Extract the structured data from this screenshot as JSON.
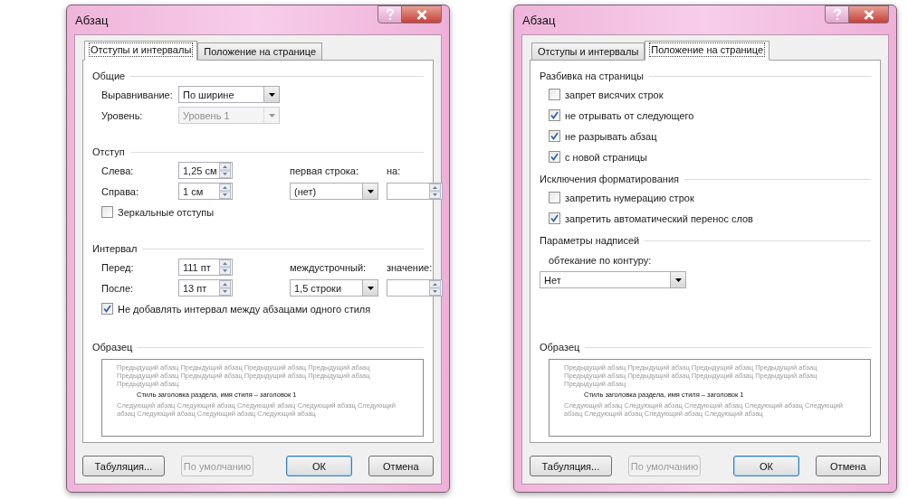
{
  "dialogs": [
    {
      "title": "Абзац",
      "tabs": [
        {
          "label": "Отступы и интервалы",
          "selected": true
        },
        {
          "label": "Положение на странице",
          "selected": false
        }
      ],
      "sections": [
        {
          "heading": "Общие",
          "rows": [
            [
              {
                "kind": "label",
                "text": "Выравнивание:"
              },
              {
                "kind": "select",
                "value": "По ширине",
                "disabled": false
              }
            ],
            [
              {
                "kind": "label",
                "text": "Уровень:"
              },
              {
                "kind": "select",
                "value": "Уровень 1",
                "disabled": true
              }
            ]
          ]
        },
        {
          "heading": "Отступ",
          "rows": [
            [
              {
                "kind": "label",
                "text": "Слева:"
              },
              {
                "kind": "spin",
                "value": "1,25 см"
              },
              {
                "kind": "label",
                "text": "первая строка:"
              },
              {
                "kind": "label",
                "text": "на:"
              }
            ],
            [
              {
                "kind": "label",
                "text": "Справа:"
              },
              {
                "kind": "spin",
                "value": "1 см"
              },
              {
                "kind": "select",
                "value": "(нет)",
                "disabled": false
              },
              {
                "kind": "spin"
              }
            ],
            [
              {
                "kind": "checkbox",
                "text": "Зеркальные отступы",
                "checked": false
              }
            ]
          ]
        },
        {
          "heading": "Интервал",
          "rows": [
            [
              {
                "kind": "label",
                "text": "Перед:"
              },
              {
                "kind": "spin",
                "value": "111 пт"
              },
              {
                "kind": "label",
                "text": "междустрочный:"
              },
              {
                "kind": "label",
                "text": "значение:"
              }
            ],
            [
              {
                "kind": "label",
                "text": "После:"
              },
              {
                "kind": "spin",
                "value": "13 пт"
              },
              {
                "kind": "select",
                "value": "1,5 строки",
                "disabled": false
              },
              {
                "kind": "spin"
              }
            ],
            [
              {
                "kind": "checkbox",
                "text": "Не добавлять интервал между абзацами одного стиля",
                "checked": true
              }
            ]
          ]
        }
      ],
      "sample": {
        "heading": "Образец",
        "previous": "Предыдущий абзац Предыдущий абзац Предыдущий абзац Предыдущий абзац Предыдущий абзац Предыдущий абзац Предыдущий абзац Предыдущий абзац Предыдущий абзац",
        "current": "Стиль заголовка раздела, имя стиля – заголовок 1",
        "next": "Следующий абзац Следующий абзац Следующий абзац Следующий абзац Следующий абзац Следующий абзац Следующий абзац Следующий абзац"
      },
      "buttons": [
        {
          "label": "Табуляция...",
          "disabled": false,
          "default": false
        },
        {
          "label": "По умолчанию",
          "disabled": true,
          "default": false
        },
        {
          "label": "ОК",
          "disabled": false,
          "default": true
        },
        {
          "label": "Отмена",
          "disabled": false,
          "default": false
        }
      ]
    },
    {
      "title": "Абзац",
      "tabs": [
        {
          "label": "Отступы и интервалы",
          "selected": false
        },
        {
          "label": "Положение на странице",
          "selected": true
        }
      ],
      "sections": [
        {
          "heading": "Разбивка на страницы",
          "rows": [
            [
              {
                "kind": "checkbox",
                "text": "запрет висячих строк",
                "checked": false
              }
            ],
            [
              {
                "kind": "checkbox",
                "text": "не отрывать от следующего",
                "checked": true
              }
            ],
            [
              {
                "kind": "checkbox",
                "text": "не разрывать абзац",
                "checked": true
              }
            ],
            [
              {
                "kind": "checkbox",
                "text": "с новой страницы",
                "checked": true
              }
            ]
          ]
        },
        {
          "heading": "Исключения форматирования",
          "rows": [
            [
              {
                "kind": "checkbox",
                "text": "запретить нумерацию строк",
                "checked": false
              }
            ],
            [
              {
                "kind": "checkbox",
                "text": "запретить автоматический перенос слов",
                "checked": true
              }
            ]
          ]
        },
        {
          "heading": "Параметры надписей",
          "rows": [
            [
              {
                "kind": "caption",
                "text": "обтекание по контуру:"
              }
            ],
            [
              {
                "kind": "wide-select",
                "value": "Нет",
                "disabled": false
              }
            ]
          ]
        }
      ],
      "sample": {
        "heading": "Образец",
        "previous": "Предыдущий абзац Предыдущий абзац Предыдущий абзац Предыдущий абзац Предыдущий абзац Предыдущий абзац Предыдущий абзац Предыдущий абзац Предыдущий абзац",
        "current": "Стиль заголовка раздела, имя стиля – заголовок 1",
        "next": "Следующий абзац Следующий абзац Следующий абзац Следующий абзац Следующий абзац Следующий абзац Следующий абзац Следующий абзац"
      },
      "buttons": [
        {
          "label": "Табуляция...",
          "disabled": false,
          "default": false
        },
        {
          "label": "По умолчанию",
          "disabled": true,
          "default": false
        },
        {
          "label": "ОК",
          "disabled": false,
          "default": true
        },
        {
          "label": "Отмена",
          "disabled": false,
          "default": false
        }
      ]
    }
  ]
}
